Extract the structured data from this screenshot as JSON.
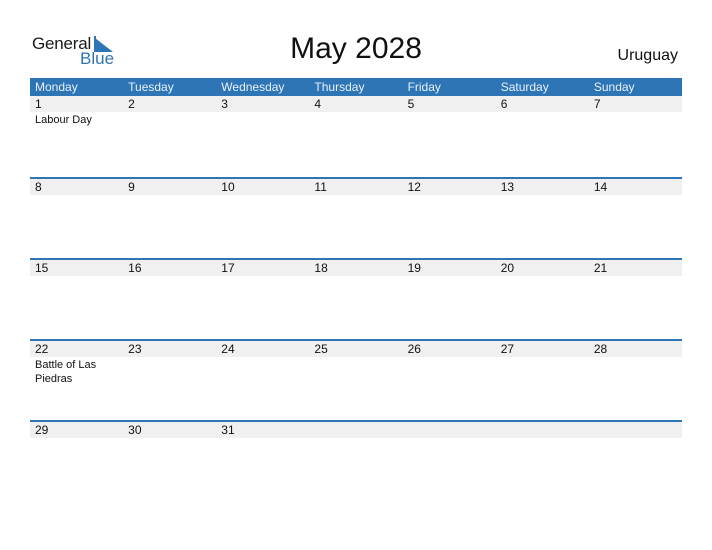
{
  "logo": {
    "general": "General",
    "blue": "Blue"
  },
  "title": "May 2028",
  "country": "Uruguay",
  "weekdays": [
    "Monday",
    "Tuesday",
    "Wednesday",
    "Thursday",
    "Friday",
    "Saturday",
    "Sunday"
  ],
  "weeks": [
    {
      "days": [
        "1",
        "2",
        "3",
        "4",
        "5",
        "6",
        "7"
      ],
      "events": [
        "Labour Day",
        "",
        "",
        "",
        "",
        "",
        ""
      ]
    },
    {
      "days": [
        "8",
        "9",
        "10",
        "11",
        "12",
        "13",
        "14"
      ],
      "events": [
        "",
        "",
        "",
        "",
        "",
        "",
        ""
      ]
    },
    {
      "days": [
        "15",
        "16",
        "17",
        "18",
        "19",
        "20",
        "21"
      ],
      "events": [
        "",
        "",
        "",
        "",
        "",
        "",
        ""
      ]
    },
    {
      "days": [
        "22",
        "23",
        "24",
        "25",
        "26",
        "27",
        "28"
      ],
      "events": [
        "Battle of Las Piedras",
        "",
        "",
        "",
        "",
        "",
        ""
      ]
    },
    {
      "days": [
        "29",
        "30",
        "31",
        "",
        "",
        "",
        ""
      ],
      "events": [
        "",
        "",
        "",
        "",
        "",
        "",
        ""
      ]
    }
  ],
  "colors": {
    "accent": "#2e75b6",
    "day_row": "#f0f0f0"
  }
}
